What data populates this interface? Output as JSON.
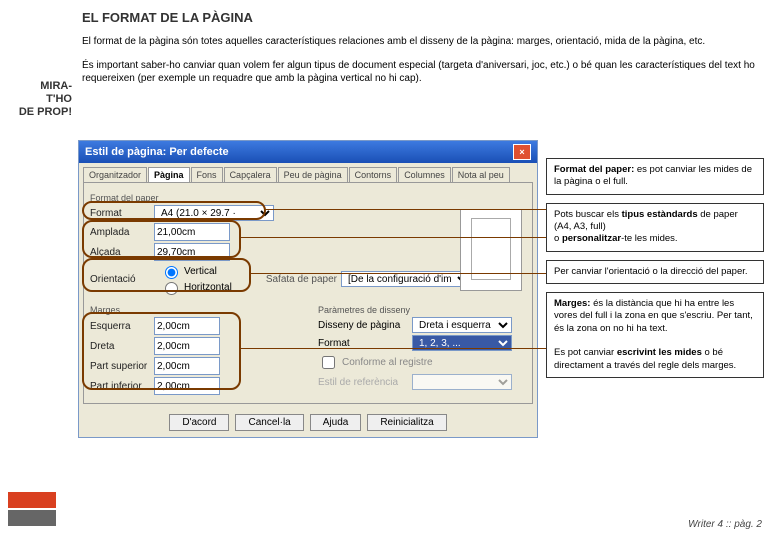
{
  "sidebar": {
    "l1": "MIRA-",
    "l2": "T'HO",
    "l3": "DE PROP!"
  },
  "heading": "EL FORMAT DE LA PÀGINA",
  "intro1": "El format de la pàgina són totes aquelles característiques relaciones amb el disseny de la pàgina: marges, orientació, mida de la pàgina, etc.",
  "intro2": "És important saber-ho canviar quan volem fer algun tipus de document especial (targeta d'aniversari, joc, etc.) o bé quan les característiques del text ho requereixen (per exemple un requadre que amb la pàgina vertical no hi cap).",
  "dialog": {
    "title": "Estil de pàgina: Per defecte",
    "tabs": [
      "Organitzador",
      "Pàgina",
      "Fons",
      "Capçalera",
      "Peu de pàgina",
      "Contorns",
      "Columnes",
      "Nota al peu"
    ],
    "active_tab": 1,
    "section_format": "Format del paper",
    "format_lbl": "Format",
    "format_val": "A4 (21.0 × 29.7 ·",
    "amplada_lbl": "Amplada",
    "amplada_val": "21,00cm",
    "alcada_lbl": "Alçada",
    "alcada_val": "29,70cm",
    "orient_lbl": "Orientació",
    "vert": "Vertical",
    "horiz": "Horitzontal",
    "safata_lbl": "Safata de paper",
    "safata_val": "[De la configuració d'impresso",
    "marges_lbl": "Marges",
    "param_lbl": "Paràmetres de disseny",
    "esq_lbl": "Esquerra",
    "esq_val": "2,00cm",
    "dreta_lbl": "Dreta",
    "dreta_val": "2,00cm",
    "sup_lbl": "Part superior",
    "sup_val": "2,00cm",
    "inf_lbl": "Part inferior",
    "inf_val": "2,00cm",
    "disseny_lbl": "Disseny de pàgina",
    "disseny_val": "Dreta i esquerra",
    "fmt_lbl": "Format",
    "fmt_val": "1, 2, 3, ...",
    "conf": "Conforme al registre",
    "ref": "Estil de referència",
    "btns": [
      "D'acord",
      "Cancel·la",
      "Ajuda",
      "Reinicialitza"
    ]
  },
  "callouts": {
    "c1a": "Format del paper:",
    "c1b": " es pot canviar les mides de la pàgina o el full.",
    "c2a": "Pots buscar els ",
    "c2b": "tipus estàndards",
    "c2c": " de paper (A4, A3, full)",
    "c2d": "o ",
    "c2e": "personalitzar",
    "c2f": "-te les mides.",
    "c3": "Per canviar l'orientació o la direcció del paper.",
    "c4a": "Marges:",
    "c4b": " és la distància que hi ha entre les vores del full i la zona en que s'escriu. Per tant, és la zona on no hi ha text.",
    "c4c": "Es pot canviar ",
    "c4d": "escrivint les mides",
    "c4e": " o bé directament a través del regle dels marges."
  },
  "footer": "Writer 4 :: pàg. 2"
}
